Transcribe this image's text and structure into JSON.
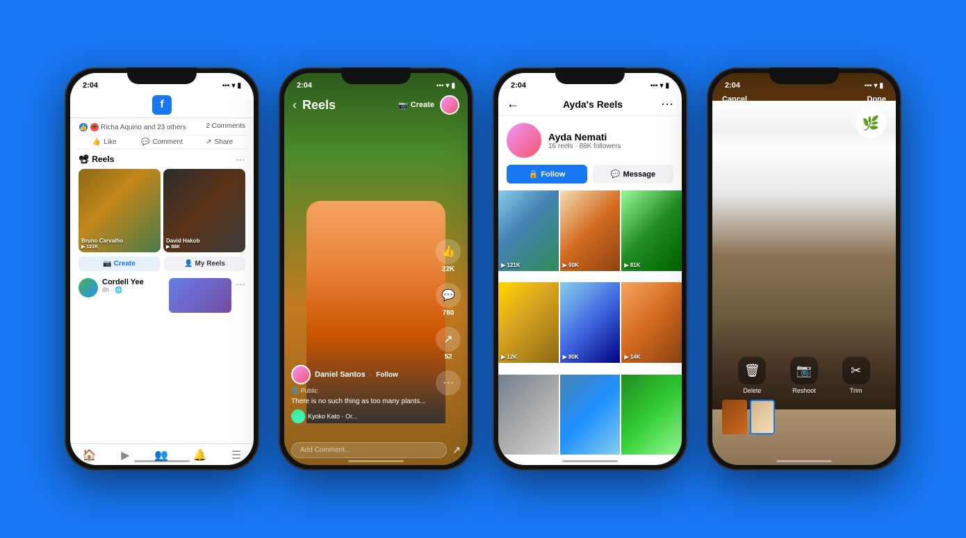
{
  "background_color": "#1877F2",
  "phone1": {
    "status_time": "2:04",
    "reactions_text": "Richa Aquino and 23 others",
    "comments_text": "2 Comments",
    "like_label": "Like",
    "comment_label": "Comment",
    "share_label": "Share",
    "reels_section_label": "Reels",
    "reel1": {
      "author": "Bruno Carvalho",
      "views": "▶ 121K"
    },
    "reel2": {
      "author": "David Hakob",
      "views": "▶ 88K"
    },
    "create_label": "Create",
    "my_reels_label": "My Reels",
    "post_user": "Cordell Yee",
    "post_time": "8h",
    "nav_icons": [
      "🏠",
      "▶",
      "👥",
      "🔔",
      "☰"
    ]
  },
  "phone2": {
    "status_time": "2:04",
    "title": "Reels",
    "create_label": "Create",
    "username": "Daniel Santos",
    "follow_label": "Follow",
    "public_label": "Public",
    "caption": "There is no such thing as too many plants...",
    "music_text": "Kyoko Kato · Or...",
    "likes_count": "22K",
    "comments_count": "780",
    "shares_count": "52",
    "add_comment_placeholder": "Add Comment...",
    "more_options": "···"
  },
  "phone3": {
    "status_time": "2:04",
    "title": "Ayda's Reels",
    "profile_name": "Ayda Nemati",
    "profile_stats": "16 reels · 88K followers",
    "follow_label": "Follow",
    "message_label": "Message",
    "reels": [
      {
        "views": "▶ 121K",
        "bg": "rg1"
      },
      {
        "views": "▶ 90K",
        "bg": "rg2"
      },
      {
        "views": "▶ 81K",
        "bg": "rg3"
      },
      {
        "views": "▶ 12K",
        "bg": "rg4"
      },
      {
        "views": "▶ 80K",
        "bg": "rg5"
      },
      {
        "views": "▶ 14K",
        "bg": "rg6"
      },
      {
        "views": "",
        "bg": "rg7"
      },
      {
        "views": "",
        "bg": "rg8"
      },
      {
        "views": "",
        "bg": "rg9"
      }
    ]
  },
  "phone4": {
    "status_time": "2:04",
    "cancel_label": "Cancel",
    "done_label": "Done",
    "delete_label": "Delete",
    "reshoot_label": "Reshoot",
    "trim_label": "Trim",
    "delete_icon": "🗑",
    "reshoot_icon": "📷",
    "trim_icon": "✂"
  }
}
